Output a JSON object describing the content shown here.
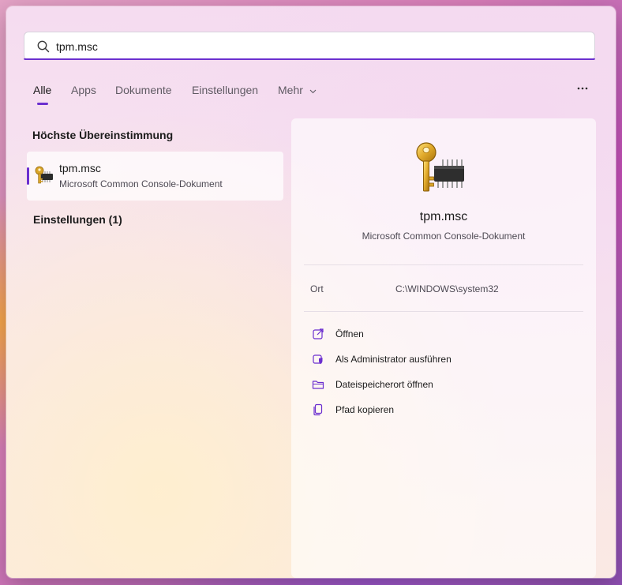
{
  "search": {
    "value": "tpm.msc",
    "placeholder": ""
  },
  "tabs": [
    {
      "label": "Alle"
    },
    {
      "label": "Apps"
    },
    {
      "label": "Dokumente"
    },
    {
      "label": "Einstellungen"
    },
    {
      "label": "Mehr"
    }
  ],
  "sections": {
    "best_match": "Höchste Übereinstimmung",
    "settings": "Einstellungen (1)"
  },
  "best_match": {
    "title": "tpm.msc",
    "subtitle": "Microsoft Common Console-Dokument"
  },
  "detail": {
    "title": "tpm.msc",
    "subtitle": "Microsoft Common Console-Dokument",
    "location_label": "Ort",
    "location_value": "C:\\WINDOWS\\system32",
    "actions": [
      {
        "label": "Öffnen",
        "icon": "open-external-icon"
      },
      {
        "label": "Als Administrator ausführen",
        "icon": "shield-admin-icon"
      },
      {
        "label": "Dateispeicherort öffnen",
        "icon": "folder-icon"
      },
      {
        "label": "Pfad kopieren",
        "icon": "copy-icon"
      }
    ]
  },
  "colors": {
    "accent": "#6b2fcf",
    "key_gold": "#d9a52a",
    "chip": "#2b2b2b"
  }
}
